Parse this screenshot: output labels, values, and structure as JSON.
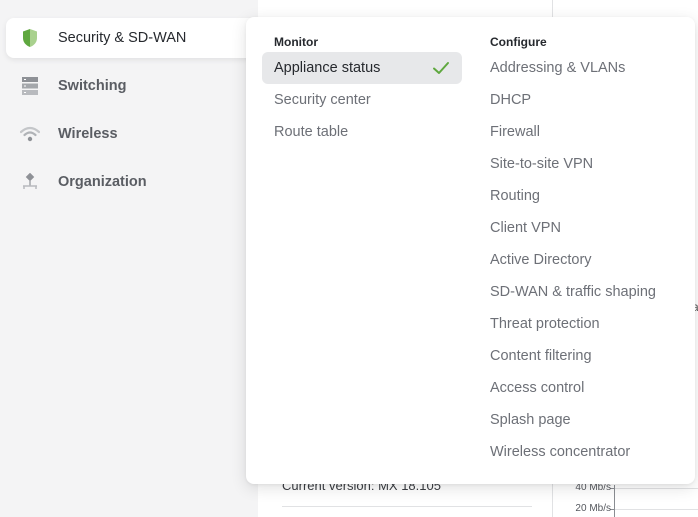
{
  "sidebar": {
    "items": [
      {
        "label": "Security & SD-WAN",
        "icon": "shield-icon",
        "active": true
      },
      {
        "label": "Switching",
        "icon": "switch-stack-icon",
        "active": false
      },
      {
        "label": "Wireless",
        "icon": "wifi-icon",
        "active": false
      },
      {
        "label": "Organization",
        "icon": "org-hierarchy-icon",
        "active": false
      }
    ]
  },
  "flyout": {
    "monitor": {
      "heading": "Monitor",
      "items": [
        {
          "label": "Appliance status",
          "selected": true,
          "icon": "check-icon"
        },
        {
          "label": "Security center",
          "selected": false
        },
        {
          "label": "Route table",
          "selected": false
        }
      ]
    },
    "configure": {
      "heading": "Configure",
      "items": [
        {
          "label": "Addressing & VLANs"
        },
        {
          "label": "DHCP"
        },
        {
          "label": "Firewall"
        },
        {
          "label": "Site-to-site VPN"
        },
        {
          "label": "Routing"
        },
        {
          "label": "Client VPN"
        },
        {
          "label": "Active Directory"
        },
        {
          "label": "SD-WAN & traffic shaping"
        },
        {
          "label": "Threat protection"
        },
        {
          "label": "Content filtering"
        },
        {
          "label": "Access control"
        },
        {
          "label": "Splash page"
        },
        {
          "label": "Wireless concentrator"
        }
      ]
    }
  },
  "background": {
    "current_version": "Current version: MX 18.105",
    "chart_axis": [
      "40 Mb/s",
      "20 Mb/s"
    ],
    "peek_text": "a"
  },
  "colors": {
    "accent_green": "#5fa83f",
    "accent_green_light": "#a9d18e",
    "selected_bg": "#e7e8ea"
  }
}
